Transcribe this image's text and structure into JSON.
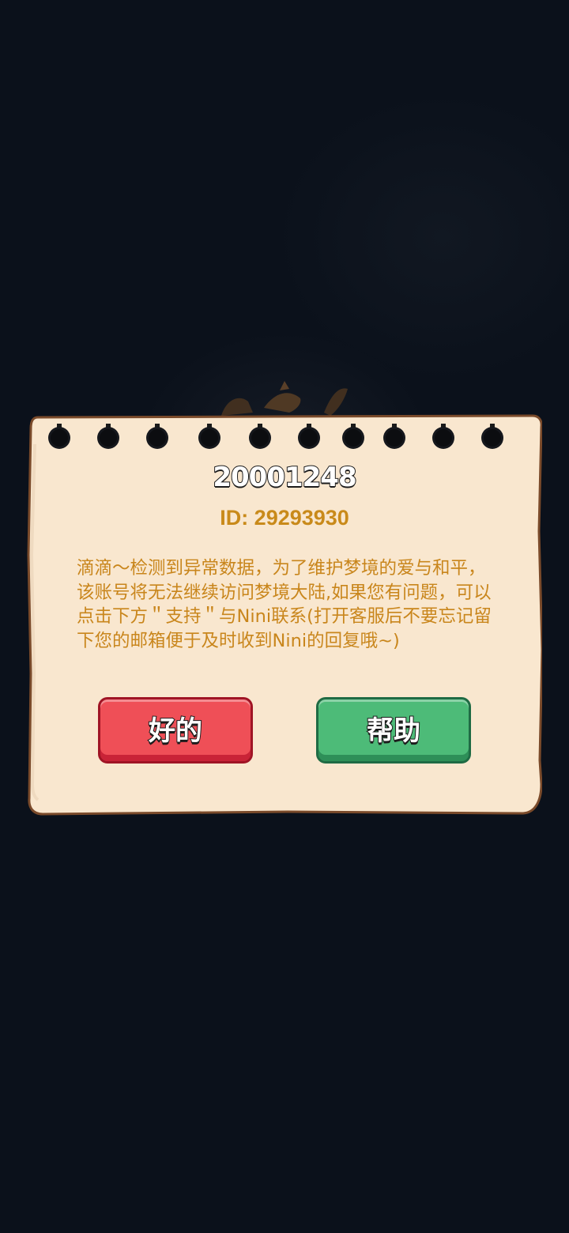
{
  "colors": {
    "background": "#0b111b",
    "paper": "#f9e7cf",
    "paper_border": "#7a4a2a",
    "accent_text": "#c98a1a",
    "ok_button": "#ef4f57",
    "help_button": "#4dbb78"
  },
  "dialog": {
    "title": "20001248",
    "user_id": "ID: 29293930",
    "message": "滴滴～检测到异常数据，为了维护梦境的爱与和平，该账号将无法继续访问梦境大陆,如果您有问题，可以点击下方＂支持＂与Nini联系(打开客服后不要忘记留下您的邮箱便于及时收到Nini的回复哦~)",
    "ok_label": "好的",
    "help_label": "帮助"
  },
  "icons": {
    "binder_ring": "notebook-ring-icon"
  }
}
